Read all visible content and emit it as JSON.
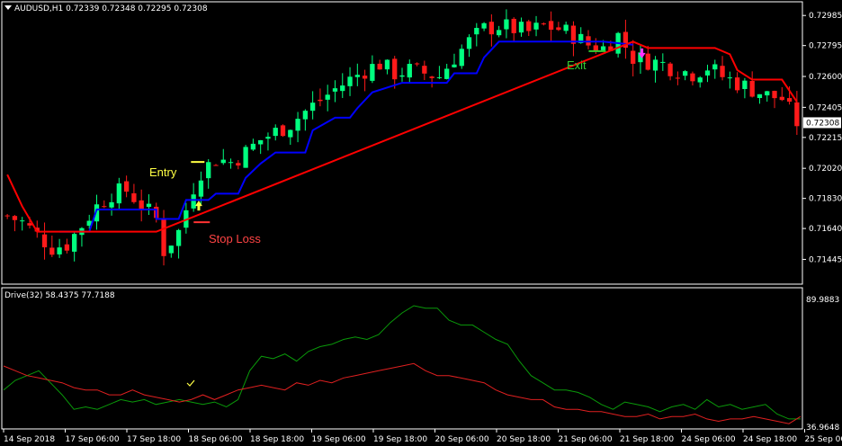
{
  "symbol_header": {
    "text": "AUDUSD,H1  0.72339 0.72348 0.72295 0.72308"
  },
  "indicator_header": {
    "text": "Drive(32) 58.4375 77.7188"
  },
  "colors": {
    "background": "#000000",
    "bull": "#00ff7f",
    "bear": "#ff1a1a",
    "support": "#0000ff",
    "resistance": "#ff0000",
    "grid": "#ffffff",
    "entry": "#ffff44",
    "stoploss": "#ff3333",
    "exit": "#33cc33",
    "osc_green": "#0a9a0a",
    "osc_red": "#e02020"
  },
  "annotations": {
    "entry": "Entry",
    "stoploss": "Stop Loss",
    "exit": "Exit"
  },
  "chart_data": [
    {
      "type": "candlestick",
      "symbol": "AUDUSD",
      "timeframe": "H1",
      "ylim": [
        0.713,
        0.7306
      ],
      "y_ticks": [
        "0.72985",
        "0.72795",
        "0.72600",
        "0.72405",
        "0.72215",
        "0.72020",
        "0.71830",
        "0.71640",
        "0.71445"
      ],
      "current_price": "0.72308",
      "x_ticks": [
        "14 Sep 2018",
        "17 Sep 06:00",
        "17 Sep 18:00",
        "18 Sep 06:00",
        "18 Sep 18:00",
        "19 Sep 06:00",
        "19 Sep 18:00",
        "20 Sep 06:00",
        "20 Sep 18:00",
        "21 Sep 06:00",
        "21 Sep 18:00",
        "24 Sep 06:00",
        "24 Sep 18:00",
        "25 Sep 06:00"
      ],
      "close_path": [
        [
          0,
          0.7172
        ],
        [
          2,
          0.7168
        ],
        [
          4,
          0.716
        ],
        [
          6,
          0.7152
        ],
        [
          8,
          0.7154
        ],
        [
          10,
          0.7166
        ],
        [
          12,
          0.7178
        ],
        [
          14,
          0.7186
        ],
        [
          16,
          0.7188
        ],
        [
          18,
          0.7179
        ],
        [
          20,
          0.717
        ],
        [
          21,
          0.715
        ],
        [
          23,
          0.7162
        ],
        [
          25,
          0.719
        ],
        [
          26,
          0.72
        ],
        [
          28,
          0.7208
        ],
        [
          30,
          0.7206
        ],
        [
          32,
          0.7212
        ],
        [
          34,
          0.722
        ],
        [
          36,
          0.7225
        ],
        [
          38,
          0.723
        ],
        [
          40,
          0.7238
        ],
        [
          42,
          0.7245
        ],
        [
          44,
          0.7252
        ],
        [
          46,
          0.7258
        ],
        [
          48,
          0.7264
        ],
        [
          50,
          0.7268
        ],
        [
          52,
          0.7262
        ],
        [
          54,
          0.7264
        ],
        [
          56,
          0.7262
        ],
        [
          58,
          0.726
        ],
        [
          60,
          0.7272
        ],
        [
          62,
          0.7282
        ],
        [
          64,
          0.729
        ],
        [
          66,
          0.7292
        ],
        [
          68,
          0.729
        ],
        [
          70,
          0.7288
        ],
        [
          72,
          0.7292
        ],
        [
          74,
          0.729
        ],
        [
          76,
          0.7286
        ],
        [
          78,
          0.728
        ],
        [
          80,
          0.7278
        ],
        [
          82,
          0.7286
        ],
        [
          84,
          0.7272
        ],
        [
          86,
          0.727
        ],
        [
          88,
          0.7268
        ],
        [
          90,
          0.7264
        ],
        [
          92,
          0.7262
        ],
        [
          94,
          0.7266
        ],
        [
          96,
          0.726
        ],
        [
          98,
          0.7256
        ],
        [
          100,
          0.7252
        ],
        [
          102,
          0.7248
        ],
        [
          104,
          0.7246
        ],
        [
          106,
          0.7231
        ]
      ],
      "support": [
        [
          0,
          null
        ],
        [
          7,
          null
        ],
        [
          7,
          0.7162
        ],
        [
          11,
          0.7162
        ],
        [
          12,
          0.7176
        ],
        [
          20,
          0.7176
        ],
        [
          20,
          0.717
        ],
        [
          23,
          0.717
        ],
        [
          24,
          0.7182
        ],
        [
          27,
          0.7182
        ],
        [
          28,
          0.7186
        ],
        [
          31,
          0.7186
        ],
        [
          32,
          0.7196
        ],
        [
          34,
          0.7205
        ],
        [
          36,
          0.7212
        ],
        [
          40,
          0.7212
        ],
        [
          41,
          0.7226
        ],
        [
          44,
          0.7234
        ],
        [
          46,
          0.7234
        ],
        [
          47,
          0.724
        ],
        [
          49,
          0.725
        ],
        [
          53,
          0.7256
        ],
        [
          59,
          0.7256
        ],
        [
          60,
          0.7262
        ],
        [
          63,
          0.7262
        ],
        [
          64,
          0.7272
        ],
        [
          66,
          0.7282
        ],
        [
          72,
          0.7282
        ],
        [
          80,
          0.7282
        ],
        [
          84,
          0.728
        ]
      ],
      "resistance": [
        [
          0,
          0.7198
        ],
        [
          2,
          0.7178
        ],
        [
          4,
          0.7162
        ],
        [
          9,
          0.7162
        ],
        [
          20,
          0.7162
        ],
        [
          84,
          0.7282
        ],
        [
          86,
          0.7278
        ],
        [
          95,
          0.7278
        ],
        [
          97,
          0.7274
        ],
        [
          98,
          0.7264
        ],
        [
          100,
          0.7258
        ],
        [
          104,
          0.7258
        ],
        [
          106,
          0.7244
        ]
      ],
      "markers": {
        "entry_x": 25.5,
        "entry_y": 0.7206,
        "stop_y": 0.7168,
        "exit_x": 79.5,
        "exit_y": 0.7276,
        "buy_arrow_x": 25.7,
        "sell_arrow_x": 85.2
      }
    },
    {
      "type": "line",
      "name": "Drive(32)",
      "values_text": "58.4375 77.7188",
      "ylim": [
        36.9648,
        89.9883
      ],
      "y_ticks": [
        "89.9883",
        "36.9648"
      ],
      "series": [
        {
          "color": "green",
          "values": [
            52,
            56,
            58,
            60,
            55,
            50,
            44,
            45,
            44,
            46,
            48,
            47,
            48,
            46,
            47,
            48,
            47,
            46,
            47,
            45,
            48,
            60,
            66,
            65,
            67,
            64,
            68,
            70,
            71,
            73,
            74,
            73,
            75,
            80,
            84,
            87,
            86,
            86,
            81,
            79,
            79,
            76,
            73,
            71,
            64,
            58,
            55,
            52,
            52,
            51,
            49,
            46,
            44,
            47,
            46,
            45,
            43,
            45,
            46,
            44,
            48,
            45,
            46,
            44,
            45,
            46,
            42,
            40,
            40
          ]
        },
        {
          "color": "red",
          "values": [
            62,
            60,
            58,
            57,
            56,
            55,
            53,
            52,
            52,
            50,
            50,
            52,
            50,
            49,
            48,
            47,
            48,
            50,
            48,
            50,
            52,
            53,
            54,
            53,
            52,
            55,
            54,
            56,
            55,
            57,
            58,
            59,
            60,
            61,
            62,
            63,
            60,
            58,
            58,
            57,
            56,
            55,
            52,
            50,
            49,
            48,
            48,
            45,
            44,
            44,
            43,
            43,
            42,
            41,
            41,
            42,
            40,
            41,
            41,
            42,
            40,
            39,
            40,
            40,
            41,
            40,
            39,
            38,
            41
          ]
        }
      ]
    }
  ]
}
